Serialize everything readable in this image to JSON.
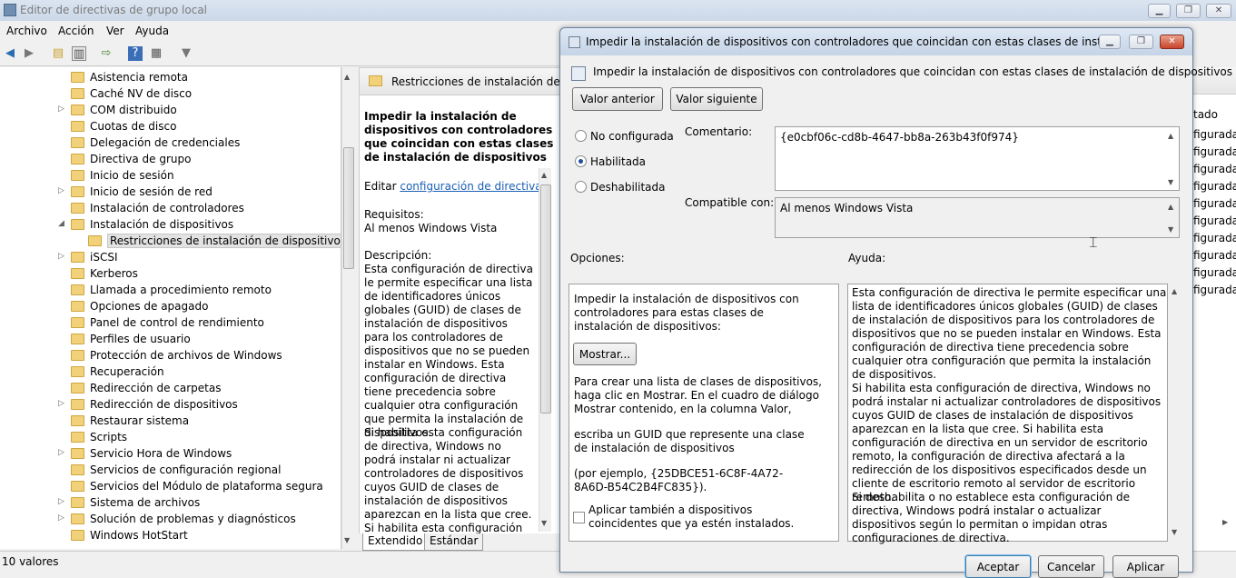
{
  "window": {
    "title": "Editor de directivas de grupo local"
  },
  "menu": [
    "Archivo",
    "Acción",
    "Ver",
    "Ayuda"
  ],
  "tree": {
    "items": [
      {
        "label": "Asistencia remota",
        "expandable": false
      },
      {
        "label": "Caché NV de disco",
        "expandable": false
      },
      {
        "label": "COM distribuido",
        "expandable": true
      },
      {
        "label": "Cuotas de disco",
        "expandable": false
      },
      {
        "label": "Delegación de credenciales",
        "expandable": false
      },
      {
        "label": "Directiva de grupo",
        "expandable": false
      },
      {
        "label": "Inicio de sesión",
        "expandable": false
      },
      {
        "label": "Inicio de sesión de red",
        "expandable": true
      },
      {
        "label": "Instalación de controladores",
        "expandable": false
      },
      {
        "label": "Instalación de dispositivos",
        "expandable": true,
        "expanded": true
      },
      {
        "label": "Restricciones de instalación de dispositivos",
        "child": true,
        "selected": true
      },
      {
        "label": "iSCSI",
        "expandable": true
      },
      {
        "label": "Kerberos",
        "expandable": false
      },
      {
        "label": "Llamada a procedimiento remoto",
        "expandable": false
      },
      {
        "label": "Opciones de apagado",
        "expandable": false
      },
      {
        "label": "Panel de control de rendimiento",
        "expandable": false
      },
      {
        "label": "Perfiles de usuario",
        "expandable": false
      },
      {
        "label": "Protección de archivos de Windows",
        "expandable": false
      },
      {
        "label": "Recuperación",
        "expandable": false
      },
      {
        "label": "Redirección de carpetas",
        "expandable": false
      },
      {
        "label": "Redirección de dispositivos",
        "expandable": true
      },
      {
        "label": "Restaurar sistema",
        "expandable": false
      },
      {
        "label": "Scripts",
        "expandable": false
      },
      {
        "label": "Servicio Hora de Windows",
        "expandable": true
      },
      {
        "label": "Servicios de configuración regional",
        "expandable": false
      },
      {
        "label": "Servicios del Módulo de plataforma segura",
        "expandable": false
      },
      {
        "label": "Sistema de archivos",
        "expandable": true
      },
      {
        "label": "Solución de problemas y diagnósticos",
        "expandable": true
      },
      {
        "label": "Windows HotStart",
        "expandable": false
      }
    ]
  },
  "middle": {
    "header": "Restricciones de instalación de dispositivos",
    "policy_title": "Impedir la instalación de dispositivos con controladores que coincidan con estas clases de instalación de dispositivos",
    "edit_prefix": "Editar ",
    "edit_link": "configuración de directiva",
    "req_label": "Requisitos:",
    "req_value": "Al menos Windows Vista",
    "desc_label": "Descripción:",
    "desc_text": "Esta configuración de directiva le permite especificar una lista de identificadores únicos globales (GUID) de clases de instalación de dispositivos para los controladores de dispositivos que no se pueden instalar en Windows. Esta configuración de directiva tiene precedencia sobre cualquier otra configuración que permita la instalación de dispositivos.",
    "desc_text2": "Si habilita esta configuración de directiva, Windows no podrá instalar ni actualizar controladores de dispositivos cuyos GUID de clases de instalación de dispositivos aparezcan en la lista que cree. Si habilita esta configuración de directiva en un",
    "tabs": [
      "Extendido",
      "Estándar"
    ]
  },
  "right_column": {
    "header": "tado",
    "rows": [
      "figurada",
      "figurada",
      "figurada",
      "figurada",
      "figurada",
      "figurada",
      "figurada",
      "figurada",
      "figurada",
      "figurada"
    ]
  },
  "status": {
    "text": "10 valores"
  },
  "dialog": {
    "title": "Impedir la instalación de dispositivos con controladores que coincidan con estas clases de instalación de...",
    "heading": "Impedir la instalación de dispositivos con controladores que coincidan con estas clases de instalación de dispositivos",
    "prev_button": "Valor anterior",
    "next_button": "Valor siguiente",
    "radio_not_configured": "No configurada",
    "radio_enabled": "Habilitada",
    "radio_disabled": "Deshabilitada",
    "comment_label": "Comentario:",
    "comment_value": "{e0cbf06c-cd8b-4647-bb8a-263b43f0f974}",
    "supported_label": "Compatible con:",
    "supported_value": "Al menos Windows Vista",
    "options_label": "Opciones:",
    "help_label": "Ayuda:",
    "options_text1": "Impedir la instalación de dispositivos con controladores para estas clases de instalación de dispositivos:",
    "show_button": "Mostrar...",
    "options_text2": "Para crear una lista de clases de dispositivos, haga clic en Mostrar. En el cuadro de diálogo Mostrar contenido, en la columna Valor,",
    "options_text3": "escriba un GUID que represente una clase de instalación de dispositivos",
    "options_text4": "(por ejemplo, {25DBCE51-6C8F-4A72-8A6D-B54C2B4FC835}).",
    "checkbox_label": "Aplicar también a dispositivos coincidentes que ya estén instalados.",
    "help_p1": "Esta configuración de directiva le permite especificar una lista de identificadores únicos globales (GUID) de clases de instalación de dispositivos para los controladores de dispositivos que no se pueden instalar en Windows. Esta configuración de directiva tiene precedencia sobre cualquier otra configuración que permita la instalación de dispositivos.",
    "help_p2": "Si habilita esta configuración de directiva, Windows no podrá instalar ni actualizar controladores de dispositivos cuyos GUID de clases de instalación de dispositivos aparezcan en la lista que cree. Si habilita esta configuración de directiva en un servidor de escritorio remoto, la configuración de directiva afectará a la redirección de los dispositivos especificados desde un cliente de escritorio remoto al servidor de escritorio remoto.",
    "help_p3": "Si deshabilita o no establece esta configuración de directiva, Windows podrá instalar o actualizar dispositivos según lo permitan o impidan otras configuraciones de directiva.",
    "ok_button": "Aceptar",
    "cancel_button": "Cancelar",
    "apply_button": "Aplicar"
  }
}
